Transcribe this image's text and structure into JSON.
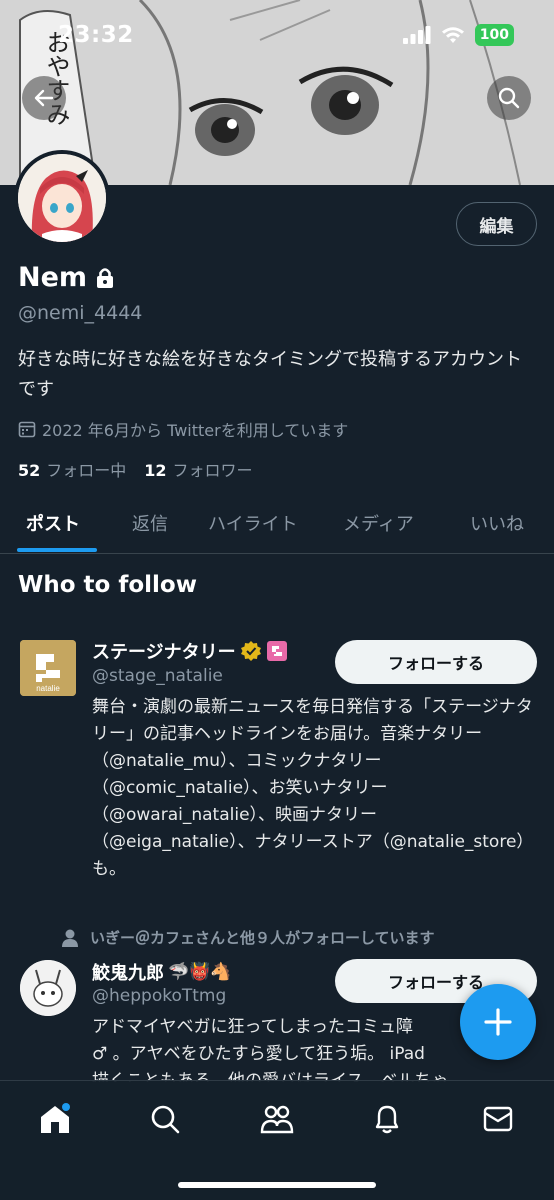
{
  "status": {
    "time": "23:32",
    "battery": "100"
  },
  "banner": {
    "text": "おやすみ"
  },
  "profile": {
    "name": "Nem",
    "handle": "@nemi_4444",
    "bio": "好きな時に好きな絵を好きなタイミングで投稿するアカウントです",
    "joined": "2022 年6月から Twitterを利用しています",
    "following_count": "52",
    "following_label": "フォロー中",
    "followers_count": "12",
    "followers_label": "フォロワー",
    "edit_label": "編集"
  },
  "tabs": [
    {
      "label": "ポスト"
    },
    {
      "label": "返信"
    },
    {
      "label": "ハイライト"
    },
    {
      "label": "メディア"
    },
    {
      "label": "いいね"
    }
  ],
  "who_to_follow": {
    "title": "Who to follow",
    "suggestions": [
      {
        "name": "ステージナタリー",
        "handle": "@stage_natalie",
        "avatar_text": "natalie",
        "follow_label": "フォローする",
        "description": "舞台・演劇の最新ニュースを毎日発信する「ステージナタリー」の記事ヘッドラインをお届け。音楽ナタリー（@natalie_mu）、コミックナタリー（@comic_natalie）、お笑いナタリー（@owarai_natalie）、映画ナタリー（@eiga_natalie）、ナタリーストア（@natalie_store）も。"
      },
      {
        "social_context": "いぎー＠カフェさんと他９人がフォローしています",
        "name": "鮫鬼九郎",
        "name_emoji": "🦈👹🐴",
        "handle": "@heppokoTtmg",
        "follow_label": "フォローする",
        "description": "アドマイヤベガに狂ってしまったコミュ障",
        "description_line2": "♂ 。アヤベをひたすら愛して狂う垢。 iPad",
        "description_line3": "描くこともある。他の愛バはライス、ベルちゃ"
      }
    ]
  },
  "colors": {
    "accent": "#1d9bf0",
    "background": "#15202b",
    "verified_gold": "#e2b719"
  },
  "nav_icons": [
    "home-icon",
    "search-icon",
    "communities-icon",
    "notifications-icon",
    "messages-icon"
  ]
}
